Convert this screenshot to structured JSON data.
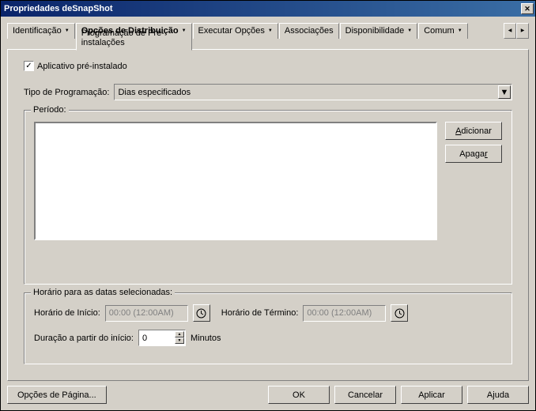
{
  "window": {
    "title": "Propriedades deSnapShot"
  },
  "tabs": {
    "ident": "Identificação",
    "dist": "Opções de Distribuição",
    "dist_sub": "Programação de Pré-instalações",
    "exec": "Executar Opções",
    "assoc": "Associações",
    "disp": "Disponibilidade",
    "comum": "Comum"
  },
  "panel": {
    "preinstalled": "Aplicativo pré-instalado",
    "tipo_label": "Tipo de Programação:",
    "tipo_value": "Dias especificados",
    "periodo_title": "Período:",
    "add": "Adicionar",
    "del": "Apagar",
    "horario_title": "Horário para as datas selecionadas:",
    "inicio_label": "Horário de Início:",
    "inicio_value": "00:00 (12:00AM)",
    "termino_label": "Horário de Término:",
    "termino_value": "00:00 (12:00AM)",
    "dur_label": "Duração a partir do início:",
    "dur_value": "0",
    "dur_unit": "Minutos"
  },
  "buttons": {
    "page_opts": "Opções de Página...",
    "ok": "OK",
    "cancel": "Cancelar",
    "apply": "Aplicar",
    "help": "Ajuda"
  }
}
